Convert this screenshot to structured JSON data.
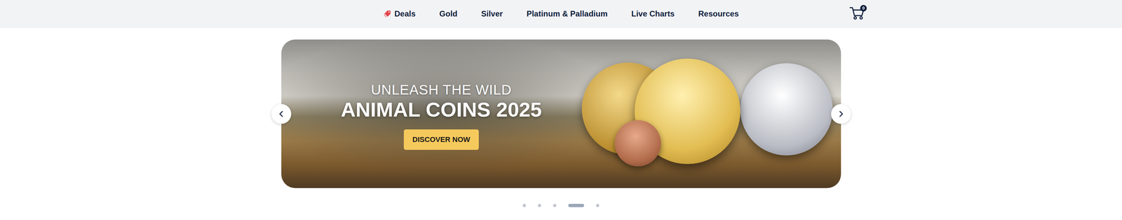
{
  "nav": {
    "items": [
      {
        "label": "Deals",
        "kind": "promo"
      },
      {
        "label": "Gold",
        "kind": "link"
      },
      {
        "label": "Silver",
        "kind": "link"
      },
      {
        "label": "Platinum & Palladium",
        "kind": "link"
      },
      {
        "label": "Live Charts",
        "kind": "link"
      },
      {
        "label": "Resources",
        "kind": "link"
      }
    ],
    "cart": {
      "count": "0"
    }
  },
  "banner": {
    "kicker": "UNLEASH THE WILD",
    "title": "ANIMAL COINS 2025",
    "cta": "DISCOVER NOW"
  },
  "carousel": {
    "dots": [
      {
        "selected": false
      },
      {
        "selected": false
      },
      {
        "selected": false
      },
      {
        "selected": true
      },
      {
        "selected": false
      }
    ]
  }
}
